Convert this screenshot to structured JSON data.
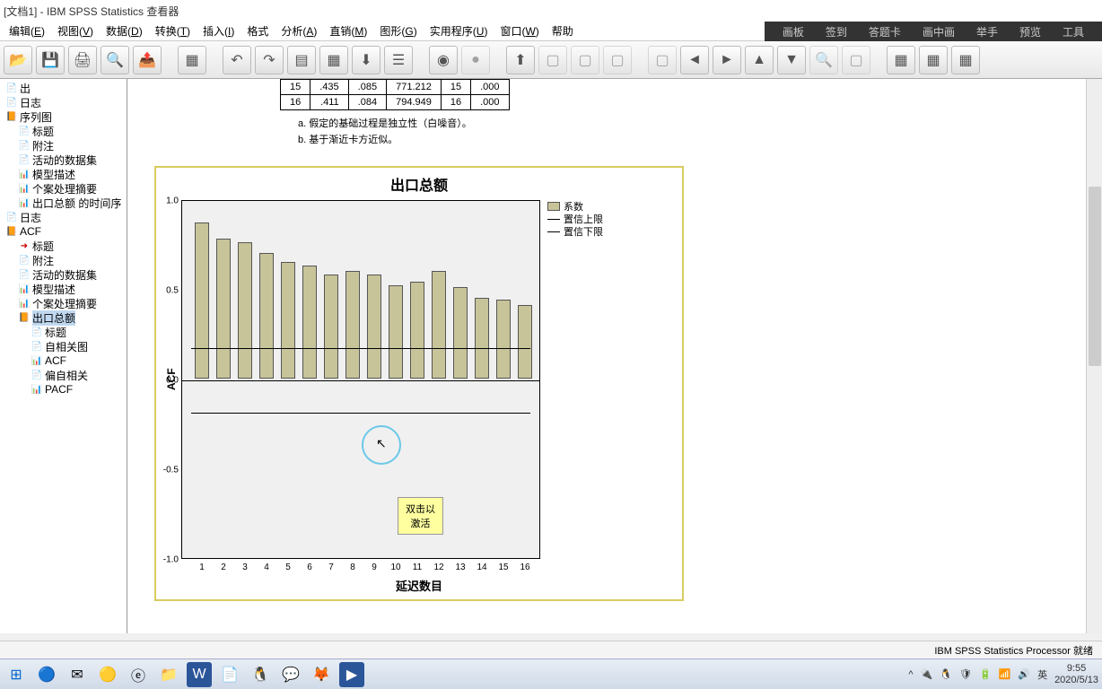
{
  "title": "[文档1] - IBM SPSS Statistics 查看器",
  "overlay": [
    "画板",
    "签到",
    "答题卡",
    "画中画",
    "举手",
    "预览",
    "工具"
  ],
  "menu": [
    {
      "t": "编辑",
      "k": "E"
    },
    {
      "t": "视图",
      "k": "V"
    },
    {
      "t": "数据",
      "k": "D"
    },
    {
      "t": "转换",
      "k": "T"
    },
    {
      "t": "插入",
      "k": "I"
    },
    {
      "t": "格式",
      "k": ""
    },
    {
      "t": "分析",
      "k": "A"
    },
    {
      "t": "直销",
      "k": "M"
    },
    {
      "t": "图形",
      "k": "G"
    },
    {
      "t": "实用程序",
      "k": "U"
    },
    {
      "t": "窗口",
      "k": "W"
    },
    {
      "t": "帮助",
      "k": ""
    }
  ],
  "tree": [
    {
      "lvl": 1,
      "txt": "出",
      "ic": "doc"
    },
    {
      "lvl": 1,
      "txt": "日志",
      "ic": "doc"
    },
    {
      "lvl": 1,
      "txt": "序列图",
      "ic": "book"
    },
    {
      "lvl": 2,
      "txt": "标题",
      "ic": "doc"
    },
    {
      "lvl": 2,
      "txt": "附注",
      "ic": "doc"
    },
    {
      "lvl": 2,
      "txt": "活动的数据集",
      "ic": "doc"
    },
    {
      "lvl": 2,
      "txt": "模型描述",
      "ic": "chart"
    },
    {
      "lvl": 2,
      "txt": "个案处理摘要",
      "ic": "chart"
    },
    {
      "lvl": 2,
      "txt": "出口总额 的时间序",
      "ic": "chart"
    },
    {
      "lvl": 1,
      "txt": "日志",
      "ic": "doc"
    },
    {
      "lvl": 1,
      "txt": "ACF",
      "ic": "book"
    },
    {
      "lvl": 2,
      "txt": "标题",
      "ic": "arrow"
    },
    {
      "lvl": 2,
      "txt": "附注",
      "ic": "doc"
    },
    {
      "lvl": 2,
      "txt": "活动的数据集",
      "ic": "doc"
    },
    {
      "lvl": 2,
      "txt": "模型描述",
      "ic": "chart"
    },
    {
      "lvl": 2,
      "txt": "个案处理摘要",
      "ic": "chart"
    },
    {
      "lvl": 2,
      "txt": "出口总额",
      "ic": "book",
      "sel": true
    },
    {
      "lvl": 3,
      "txt": "标题",
      "ic": "doc"
    },
    {
      "lvl": 3,
      "txt": "自相关图",
      "ic": "doc"
    },
    {
      "lvl": 3,
      "txt": "ACF",
      "ic": "chart"
    },
    {
      "lvl": 3,
      "txt": "偏自相关",
      "ic": "doc"
    },
    {
      "lvl": 3,
      "txt": "PACF",
      "ic": "chart"
    }
  ],
  "table_rows": [
    [
      "15",
      ".435",
      ".085",
      "771.212",
      "15",
      ".000"
    ],
    [
      "16",
      ".411",
      ".084",
      "794.949",
      "16",
      ".000"
    ]
  ],
  "note_a": "a. 假定的基础过程是独立性（白噪音）。",
  "note_b": "b. 基于渐近卡方近似。",
  "tooltip": {
    "l1": "双击以",
    "l2": "激活"
  },
  "legend": {
    "l1": "系数",
    "l2": "置信上限",
    "l3": "置信下限"
  },
  "chart_data": {
    "type": "bar",
    "title": "出口总额",
    "xlabel": "延迟数目",
    "ylabel": "ACF",
    "categories": [
      1,
      2,
      3,
      4,
      5,
      6,
      7,
      8,
      9,
      10,
      11,
      12,
      13,
      14,
      15,
      16
    ],
    "values": [
      0.87,
      0.78,
      0.76,
      0.7,
      0.65,
      0.63,
      0.58,
      0.6,
      0.58,
      0.52,
      0.54,
      0.6,
      0.51,
      0.45,
      0.44,
      0.41
    ],
    "conf_upper": 0.18,
    "conf_lower": -0.18,
    "ylim": [
      -1.0,
      1.0
    ],
    "yticks": [
      -1.0,
      -0.5,
      0.0,
      0.5,
      1.0
    ]
  },
  "status": "IBM SPSS Statistics Processor 就绪",
  "tray": {
    "ime": "英",
    "time": "9:55",
    "date": "2020/5/13"
  }
}
